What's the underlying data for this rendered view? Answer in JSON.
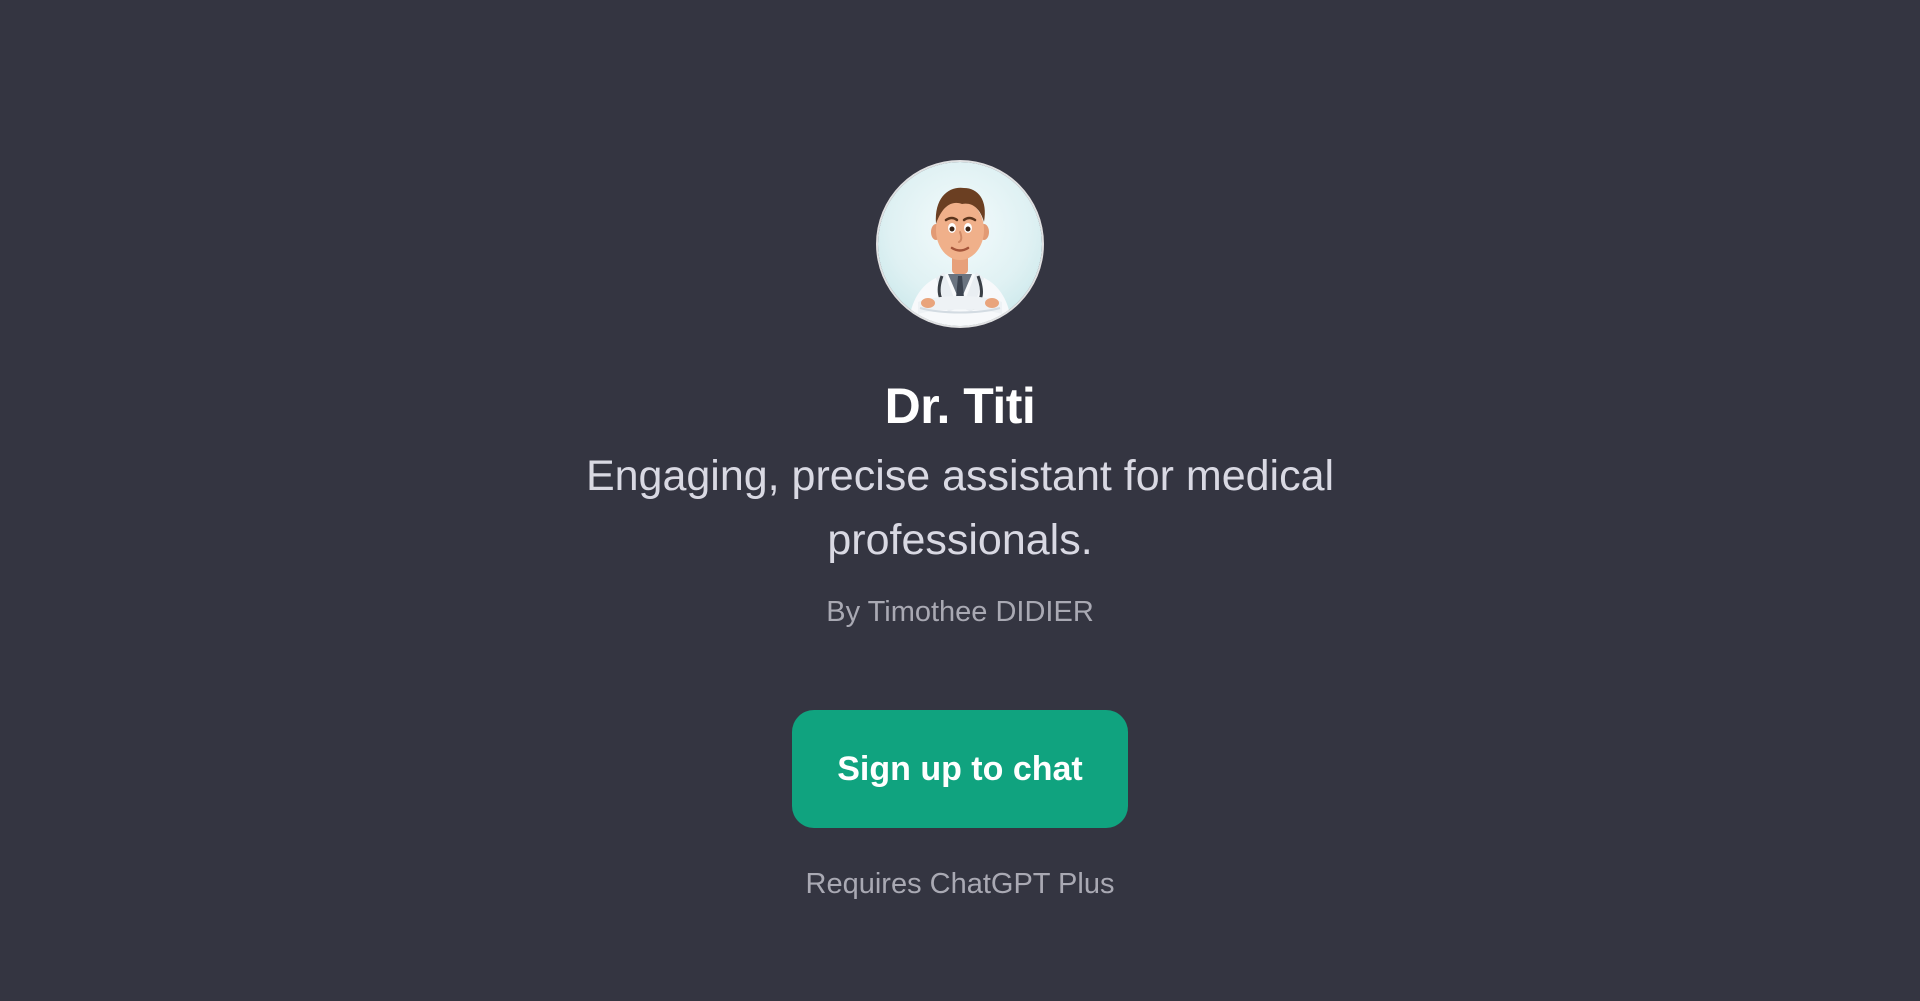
{
  "gpt": {
    "name": "Dr. Titi",
    "description": "Engaging, precise assistant for medical professionals.",
    "author": "By Timothee DIDIER",
    "avatar_icon": "doctor-avatar-icon"
  },
  "actions": {
    "signup_label": "Sign up to chat",
    "requirement": "Requires ChatGPT Plus"
  },
  "colors": {
    "background": "#343541",
    "accent": "#10a37f",
    "title": "#ffffff",
    "subtitle": "#d9d9e3",
    "muted": "#a9a9b3"
  }
}
